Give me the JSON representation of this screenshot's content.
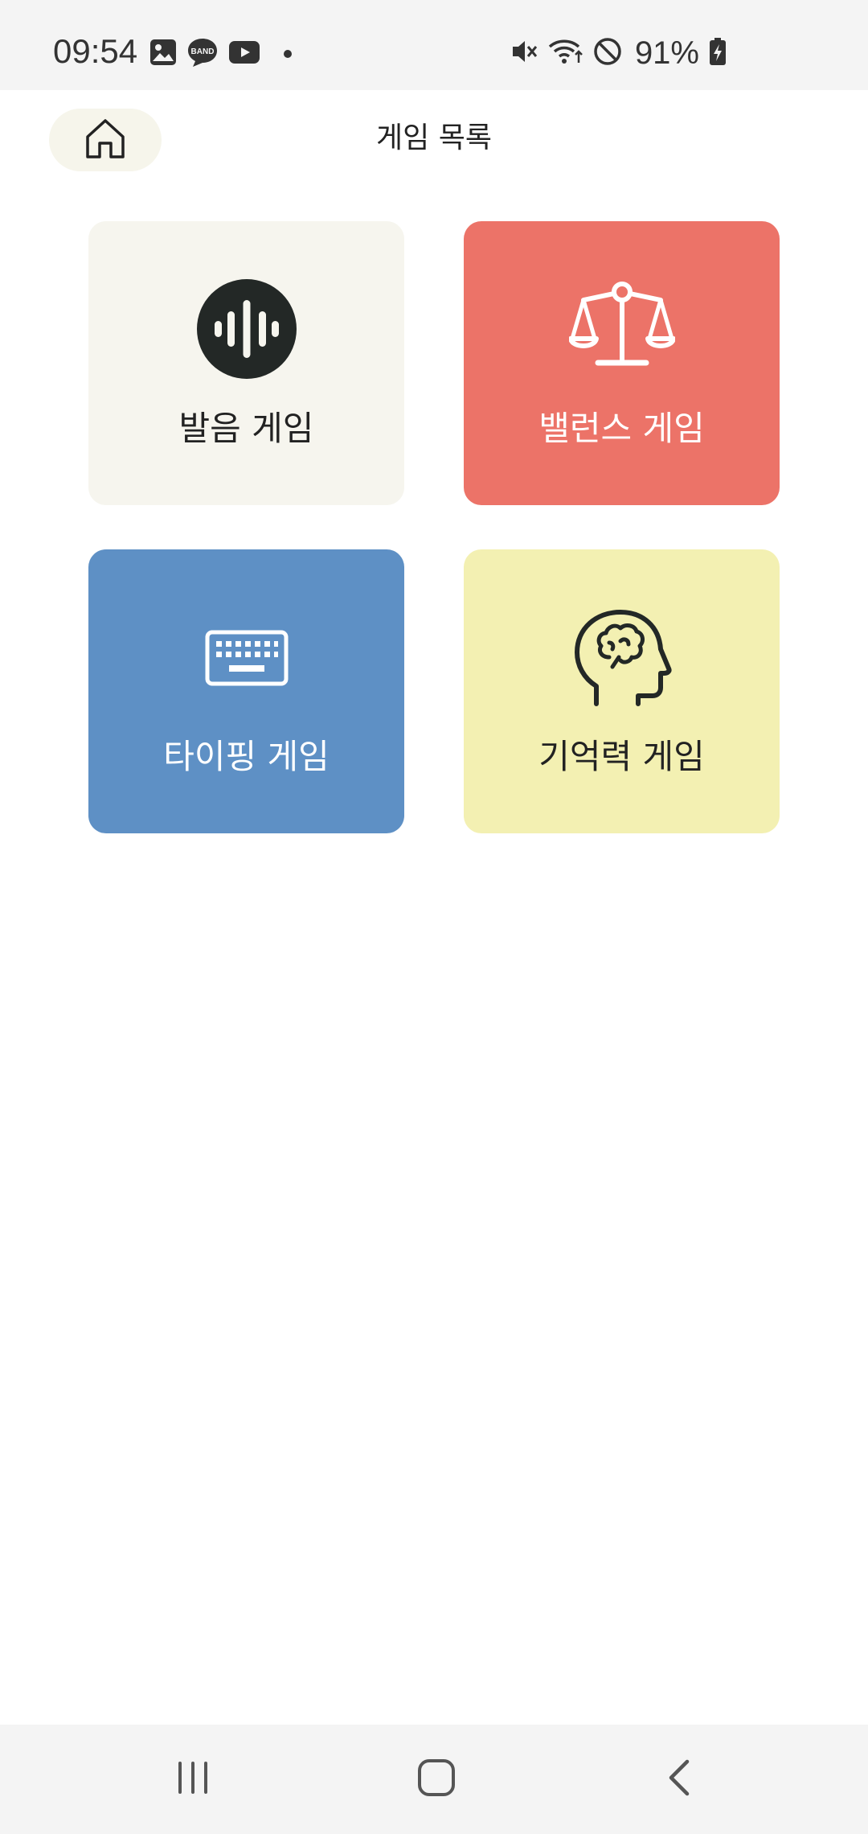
{
  "status_bar": {
    "time": "09:54",
    "battery": "91%",
    "left_icons": [
      "gallery-icon",
      "band-icon",
      "youtube-icon",
      "dot-icon"
    ],
    "right_icons": [
      "mute-icon",
      "wifi-icon",
      "do-not-disturb-icon",
      "battery-charging-icon"
    ]
  },
  "header": {
    "title": "게임 목록",
    "home_icon": "home-icon"
  },
  "games": [
    {
      "label": "발음 게임",
      "icon": "soundwave-icon",
      "bg": "#f6f5ee",
      "text_color": "#222222"
    },
    {
      "label": "밸런스 게임",
      "icon": "balance-scale-icon",
      "bg": "#ec7368",
      "text_color": "#ffffff"
    },
    {
      "label": "타이핑 게임",
      "icon": "keyboard-icon",
      "bg": "#5e90c5",
      "text_color": "#ffffff"
    },
    {
      "label": "기억력 게임",
      "icon": "brain-head-icon",
      "bg": "#f3f0b2",
      "text_color": "#222222"
    }
  ],
  "nav_bar": {
    "items": [
      "recent-apps-icon",
      "home-nav-icon",
      "back-icon"
    ]
  }
}
